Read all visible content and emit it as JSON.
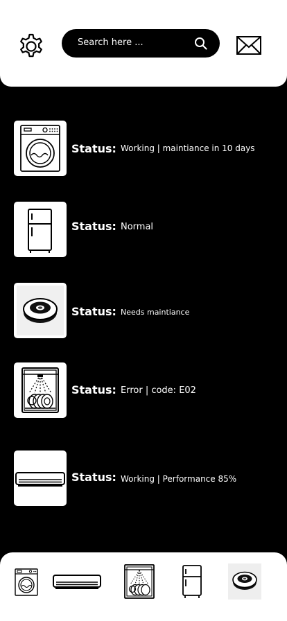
{
  "header": {
    "search": {
      "placeholder": "Search here ..."
    }
  },
  "devices": [
    {
      "icon": "washing-machine-icon",
      "status_label": "Status:",
      "status_text": "Working | maintiance in 10 days"
    },
    {
      "icon": "refrigerator-icon",
      "status_label": "Status:",
      "status_text": "Normal"
    },
    {
      "icon": "robot-vacuum-icon",
      "status_label": "Status:",
      "status_text": "Needs maintiance"
    },
    {
      "icon": "dishwasher-icon",
      "status_label": "Status:",
      "status_text": "Error | code: E02"
    },
    {
      "icon": "air-conditioner-icon",
      "status_label": "Status:",
      "status_text": "Working | Performance 85%"
    }
  ],
  "bottom_nav": {
    "items": [
      "washing-machine-icon",
      "air-conditioner-icon",
      "dishwasher-icon",
      "refrigerator-icon",
      "robot-vacuum-icon"
    ]
  },
  "colors": {
    "background": "#000000",
    "surface": "#ffffff",
    "text": "#ffffff"
  }
}
